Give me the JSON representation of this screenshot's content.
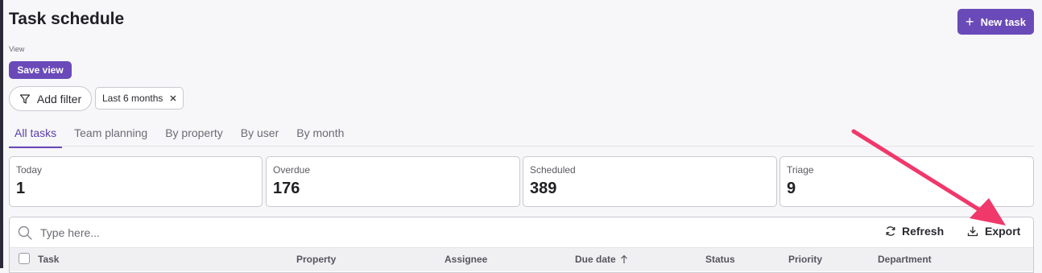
{
  "header": {
    "title": "Task schedule",
    "new_task_label": "New task",
    "view_label": "View",
    "save_view_label": "Save view"
  },
  "filters": {
    "add_filter_label": "Add filter",
    "chips": [
      {
        "label": "Last 6 months"
      }
    ]
  },
  "tabs": [
    {
      "label": "All tasks",
      "active": true
    },
    {
      "label": "Team planning",
      "active": false
    },
    {
      "label": "By property",
      "active": false
    },
    {
      "label": "By user",
      "active": false
    },
    {
      "label": "By month",
      "active": false
    }
  ],
  "stats": [
    {
      "label": "Today",
      "value": "1"
    },
    {
      "label": "Overdue",
      "value": "176"
    },
    {
      "label": "Scheduled",
      "value": "389"
    },
    {
      "label": "Triage",
      "value": "9"
    }
  ],
  "table": {
    "search_placeholder": "Type here...",
    "refresh_label": "Refresh",
    "export_label": "Export",
    "columns": [
      {
        "label": "Task"
      },
      {
        "label": "Property"
      },
      {
        "label": "Assignee"
      },
      {
        "label": "Due date",
        "sort": "ascending"
      },
      {
        "label": "Status"
      },
      {
        "label": "Priority"
      },
      {
        "label": "Department"
      }
    ]
  },
  "colors": {
    "accent": "#6a4ab8",
    "annotation": "#f0386b"
  },
  "icons": [
    "plus-icon",
    "filter-icon",
    "close-icon",
    "search-icon",
    "refresh-icon",
    "download-icon",
    "arrow-up-icon"
  ]
}
